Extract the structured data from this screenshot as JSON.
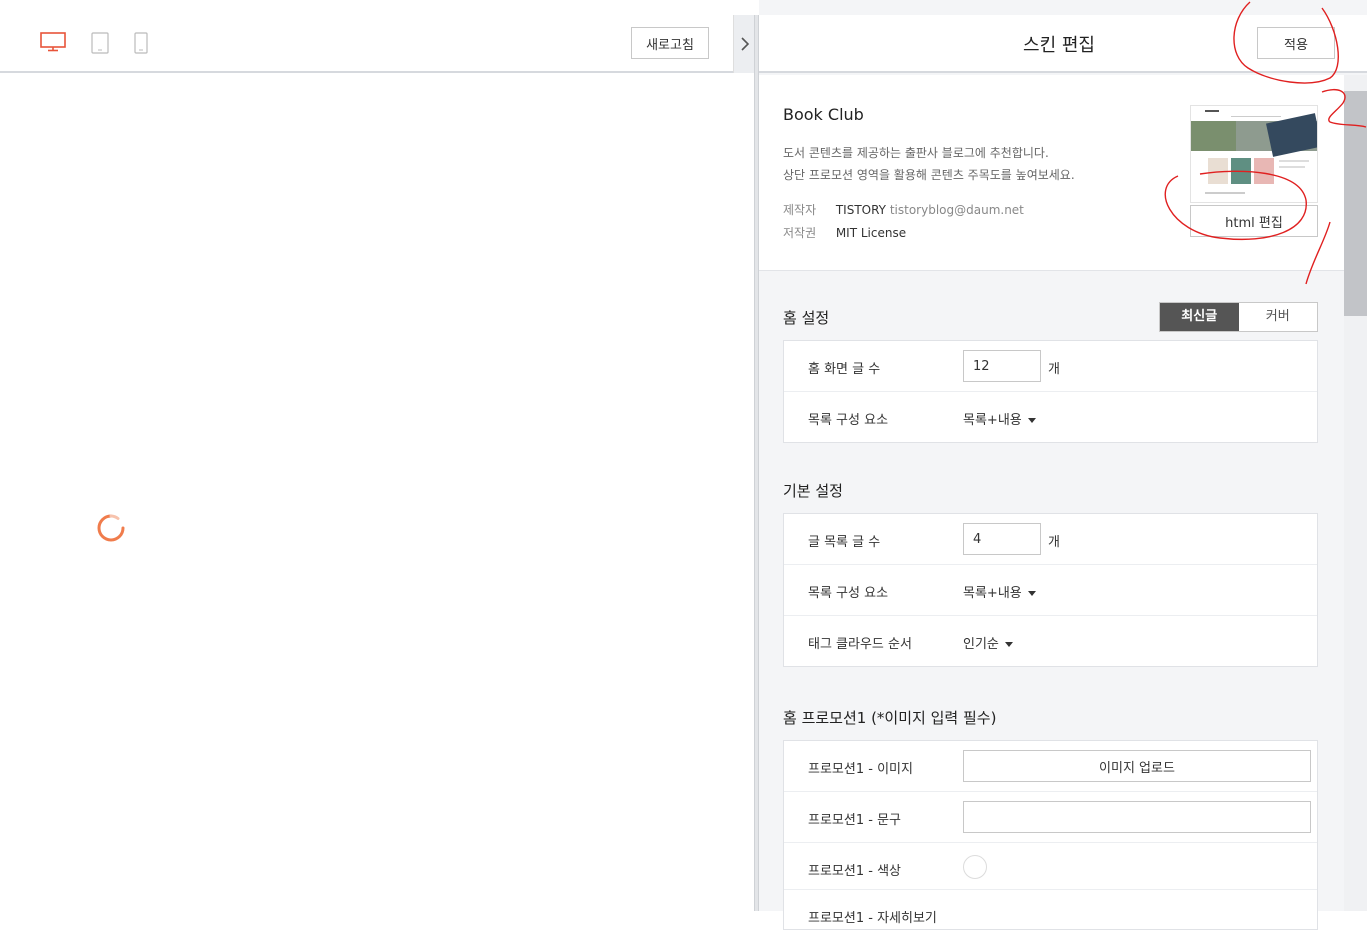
{
  "toolbar": {
    "refresh_label": "새로고침",
    "device_icons": [
      "desktop-icon",
      "tablet-icon",
      "mobile-icon"
    ],
    "active_device_color": "#e8543a"
  },
  "editor": {
    "title": "스킨 편집",
    "apply_label": "적용"
  },
  "skin": {
    "name": "Book Club",
    "desc_line1": "도서 콘텐츠를 제공하는 출판사 블로그에 추천합니다.",
    "desc_line2": "상단 프로모션 영역을 활용해 콘텐츠 주목도를 높여보세요.",
    "author_key": "제작자",
    "author_name": "TISTORY",
    "author_email": "tistoryblog@daum.net",
    "license_key": "저작권",
    "license_value": "MIT License",
    "html_edit_label": "html 편집"
  },
  "home_settings": {
    "title": "홈 설정",
    "toggle": [
      "최신글",
      "커버"
    ],
    "toggle_selected": "최신글",
    "rows": [
      {
        "label": "홈 화면 글 수",
        "value": "12",
        "unit": "개"
      },
      {
        "label": "목록 구성 요소",
        "select": "목록+내용"
      }
    ]
  },
  "basic_settings": {
    "title": "기본 설정",
    "rows": [
      {
        "label": "글 목록 글 수",
        "value": "4",
        "unit": "개"
      },
      {
        "label": "목록 구성 요소",
        "select": "목록+내용"
      },
      {
        "label": "태그 클라우드 순서",
        "select": "인기순"
      }
    ]
  },
  "promotion1": {
    "title": "홈 프로모션1 (*이미지 입력 필수)",
    "rows": [
      {
        "label": "프로모션1 - 이미지",
        "button": "이미지 업로드"
      },
      {
        "label": "프로모션1 - 문구",
        "value": ""
      },
      {
        "label": "프로모션1 - 색상"
      },
      {
        "label": "프로모션1 - 자세히보기"
      }
    ]
  },
  "annotations": {
    "ink_color": "#e02020"
  }
}
